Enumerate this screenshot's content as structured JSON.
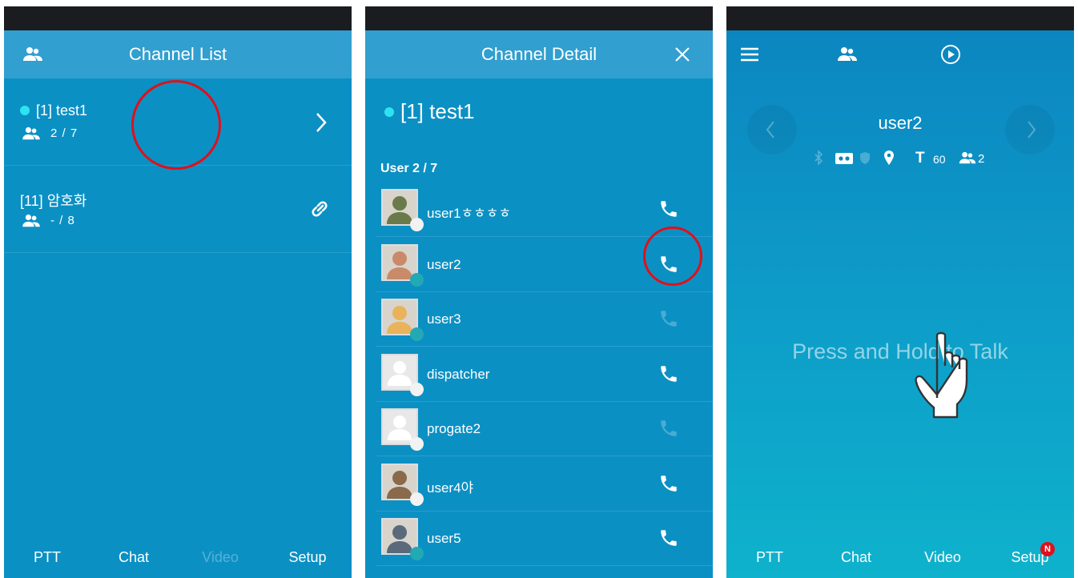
{
  "channel_list": {
    "title": "Channel List",
    "channels": [
      {
        "name": "[1] test1",
        "count": "2 / 7",
        "active": true
      },
      {
        "name": "[11] 암호화",
        "count": "- / 8",
        "active": false
      }
    ],
    "tabs": [
      "PTT",
      "Chat",
      "Video",
      "Setup"
    ]
  },
  "channel_detail": {
    "title": "Channel Detail",
    "channel_name": "[1] test1",
    "user_header": "User 2 / 7",
    "users": [
      {
        "name": "user1ㅎㅎㅎㅎ",
        "status": "offline",
        "call_enabled": true
      },
      {
        "name": "user2",
        "status": "online",
        "call_enabled": true
      },
      {
        "name": "user3",
        "status": "online",
        "call_enabled": false
      },
      {
        "name": "dispatcher",
        "status": "offline",
        "call_enabled": true
      },
      {
        "name": "progate2",
        "status": "offline",
        "call_enabled": false
      },
      {
        "name": "user4야",
        "status": "offline",
        "call_enabled": true
      },
      {
        "name": "user5",
        "status": "online",
        "call_enabled": true
      }
    ]
  },
  "ptt": {
    "current_user": "user2",
    "timer": "60",
    "member_count": "2",
    "prompt": "Press and Hold to Talk",
    "tabs": [
      "PTT",
      "Chat",
      "Video",
      "Setup"
    ],
    "setup_badge": "N"
  },
  "colors": {
    "header_bar": "#319fcf",
    "panel_bg": "#0b90c4",
    "highlight_circle": "#e0101a",
    "status_online": "#22a9b4",
    "status_offline": "#f2f2f2"
  }
}
